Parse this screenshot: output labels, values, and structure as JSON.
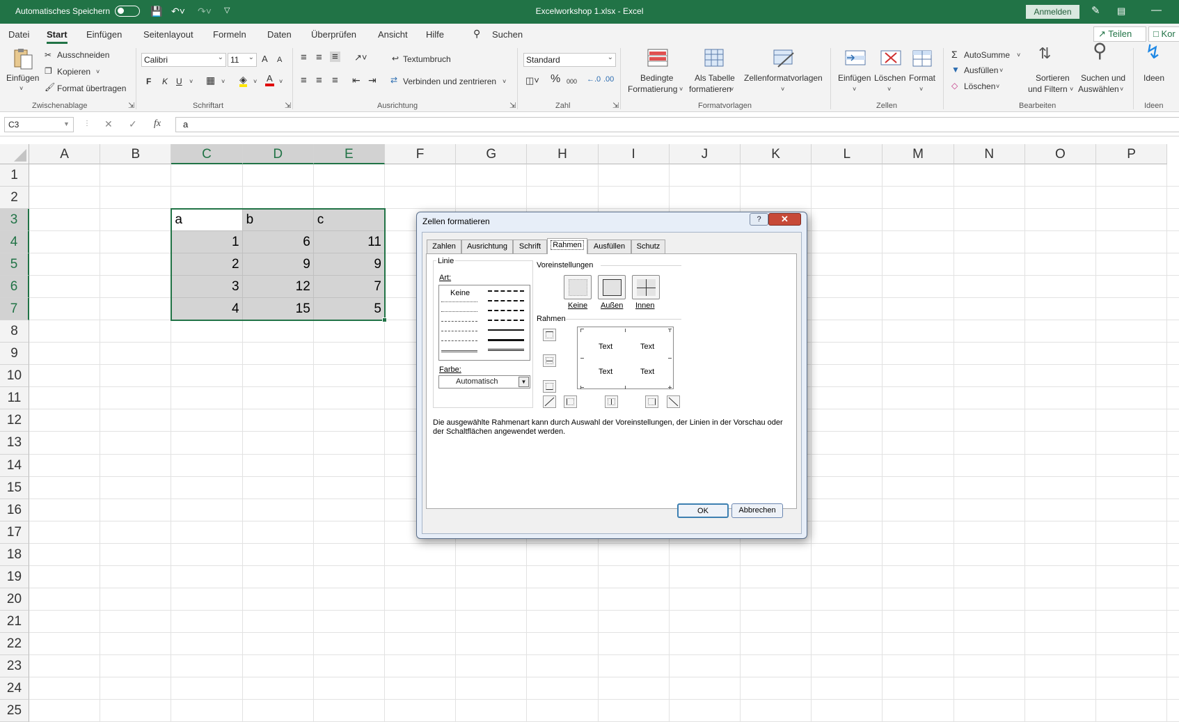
{
  "title_bar": {
    "autosave_label": "Automatisches Speichern",
    "title": "Excelworkshop 1.xlsx  -  Excel",
    "sign_in": "Anmelden"
  },
  "menu": {
    "tabs": [
      "Datei",
      "Start",
      "Einfügen",
      "Seitenlayout",
      "Formeln",
      "Daten",
      "Überprüfen",
      "Ansicht",
      "Hilfe"
    ],
    "search": "Suchen",
    "share": "Teilen",
    "comments": "Kor"
  },
  "ribbon": {
    "clipboard": {
      "paste": "Einfügen",
      "cut": "Ausschneiden",
      "copy": "Kopieren",
      "format_painter": "Format übertragen",
      "group": "Zwischenablage"
    },
    "font": {
      "name": "Calibri",
      "size": "11",
      "bold": "F",
      "italic": "K",
      "underline": "U",
      "color_letter": "A",
      "grow": "A",
      "shrink": "A",
      "group": "Schriftart"
    },
    "alignment": {
      "wrap": "Textumbruch",
      "merge": "Verbinden und zentrieren",
      "group": "Ausrichtung"
    },
    "number": {
      "format": "Standard",
      "percent": "%",
      "thousands": "000",
      "group": "Zahl"
    },
    "styles": {
      "conditional_1": "Bedingte",
      "conditional_2": "Formatierung",
      "table_1": "Als Tabelle",
      "table_2": "formatieren",
      "cell_styles": "Zellenformatvorlagen",
      "group": "Formatvorlagen"
    },
    "cells": {
      "insert": "Einfügen",
      "delete": "Löschen",
      "format": "Format",
      "group": "Zellen"
    },
    "editing": {
      "autosum": "AutoSumme",
      "fill": "Ausfüllen",
      "clear": "Löschen",
      "sort_1": "Sortieren",
      "sort_2": "und Filtern",
      "find_1": "Suchen und",
      "find_2": "Auswählen",
      "group": "Bearbeiten"
    },
    "ideas": {
      "label": "Ideen",
      "group": "Ideen"
    }
  },
  "formula_bar": {
    "name_box": "C3",
    "fx": "fx",
    "content": "a"
  },
  "sheet": {
    "columns": [
      "A",
      "B",
      "C",
      "D",
      "E",
      "F",
      "G",
      "H",
      "I",
      "J",
      "K",
      "L",
      "M",
      "N",
      "O",
      "P"
    ],
    "rows": [
      "1",
      "2",
      "3",
      "4",
      "5",
      "6",
      "7",
      "8",
      "9",
      "10",
      "11",
      "12",
      "13",
      "14",
      "15",
      "16",
      "17",
      "18",
      "19",
      "20",
      "21",
      "22",
      "23",
      "24",
      "25"
    ],
    "header_row": [
      "a",
      "b",
      "c"
    ],
    "data": [
      [
        "1",
        "6",
        "11"
      ],
      [
        "2",
        "9",
        "9"
      ],
      [
        "3",
        "12",
        "7"
      ],
      [
        "4",
        "15",
        "5"
      ]
    ]
  },
  "dialog": {
    "title": "Zellen formatieren",
    "help": "?",
    "tabs": [
      "Zahlen",
      "Ausrichtung",
      "Schrift",
      "Rahmen",
      "Ausfüllen",
      "Schutz"
    ],
    "line_group": "Linie",
    "style_label": "Art:",
    "none_style": "Keine",
    "color_label": "Farbe:",
    "color_value": "Automatisch",
    "presets_label": "Voreinstellungen",
    "presets": [
      "Keine",
      "Außen",
      "Innen"
    ],
    "border_label": "Rahmen",
    "preview_text": "Text",
    "description": "Die ausgewählte Rahmenart kann durch Auswahl der Voreinstellungen, der Linien in der Vorschau oder der Schaltflächen angewendet werden.",
    "ok": "OK",
    "cancel": "Abbrechen"
  }
}
